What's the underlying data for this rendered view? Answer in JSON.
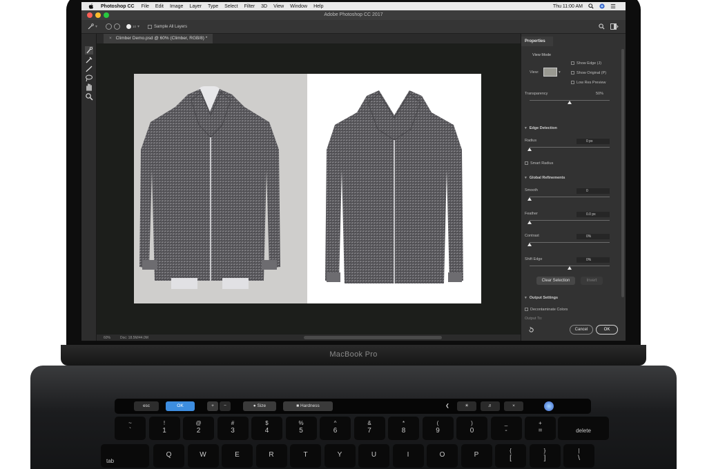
{
  "menubar": {
    "app_name": "Photoshop CC",
    "items": [
      "File",
      "Edit",
      "Image",
      "Layer",
      "Type",
      "Select",
      "Filter",
      "3D",
      "View",
      "Window",
      "Help"
    ],
    "clock": "Thu 11:00 AM"
  },
  "window": {
    "title": "Adobe Photoshop CC 2017"
  },
  "options_bar": {
    "brush_size": "10",
    "sample_all_layers": "Sample All Layers"
  },
  "document": {
    "tab": "Climber Demo.psd @ 60% (Climber, RGB/8) *",
    "zoom": "60%",
    "doc_info": "Doc: 18.5M/44.0M"
  },
  "properties": {
    "header": "Properties",
    "view_mode": {
      "label": "View Mode",
      "view_label": "View:",
      "options": [
        "Show Edge (J)",
        "Show Original (P)",
        "Low Res Preview"
      ],
      "transparency_label": "Transparency",
      "transparency_value": "50%",
      "transparency_level": 0.5
    },
    "edge_detection": {
      "label": "Edge Detection",
      "radius_label": "Radius",
      "radius_value": "0 px",
      "smart_radius": "Smart Radius"
    },
    "global_refinements": {
      "label": "Global Refinements",
      "smooth_label": "Smooth",
      "smooth_value": "0",
      "feather_label": "Feather",
      "feather_value": "0.0 px",
      "contrast_label": "Contrast",
      "contrast_value": "0%",
      "shift_edge_label": "Shift Edge",
      "shift_edge_value": "0%",
      "shift_edge_level": 0.5,
      "clear_selection": "Clear Selection",
      "invert": "Invert"
    },
    "output_settings": {
      "label": "Output Settings",
      "decontaminate": "Decontaminate Colors",
      "output_to": "Output To:"
    },
    "cancel": "Cancel",
    "ok": "OK"
  },
  "laptop": {
    "brand": "MacBook Pro"
  },
  "touchbar": {
    "esc": "esc",
    "ok": "OK",
    "size": "Size",
    "hardness": "Hardness"
  },
  "keyboard": {
    "number_row": [
      {
        "top": "~",
        "bot": "`"
      },
      {
        "top": "!",
        "bot": "1"
      },
      {
        "top": "@",
        "bot": "2"
      },
      {
        "top": "#",
        "bot": "3"
      },
      {
        "top": "$",
        "bot": "4"
      },
      {
        "top": "%",
        "bot": "5"
      },
      {
        "top": "^",
        "bot": "6"
      },
      {
        "top": "&",
        "bot": "7"
      },
      {
        "top": "*",
        "bot": "8"
      },
      {
        "top": "(",
        "bot": "9"
      },
      {
        "top": ")",
        "bot": "0"
      },
      {
        "top": "_",
        "bot": "-"
      },
      {
        "top": "+",
        "bot": "="
      }
    ],
    "delete": "delete",
    "tab": "tab",
    "letter_row": [
      "Q",
      "W",
      "E",
      "R",
      "T",
      "Y",
      "U",
      "I",
      "O",
      "P"
    ],
    "bracket_keys": [
      {
        "top": "{",
        "bot": "["
      },
      {
        "top": "}",
        "bot": "]"
      },
      {
        "top": "|",
        "bot": "\\"
      }
    ]
  },
  "colors": {
    "accent_blue": "#3d8de0",
    "screen_bg": "#1c1e1b",
    "panel_bg": "#323232"
  }
}
